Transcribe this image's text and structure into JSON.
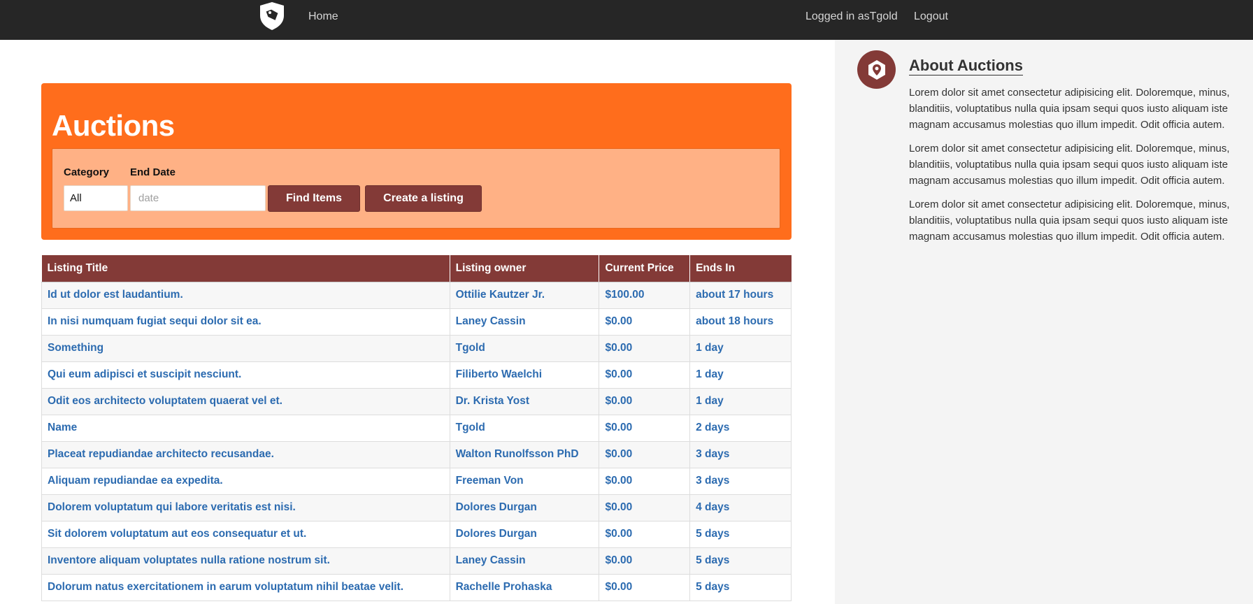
{
  "nav": {
    "home": "Home",
    "logged_in": "Logged in asTgold",
    "logout": "Logout"
  },
  "hero": {
    "title": "Auctions",
    "category_label": "Category",
    "category_value": "All",
    "end_date_label": "End Date",
    "end_date_placeholder": "date",
    "find_button": "Find Items",
    "create_button": "Create a listing"
  },
  "table": {
    "headers": [
      "Listing Title",
      "Listing owner",
      "Current Price",
      "Ends In"
    ],
    "rows": [
      [
        "Id ut dolor est laudantium.",
        "Ottilie Kautzer Jr.",
        "$100.00",
        "about 17 hours"
      ],
      [
        "In nisi numquam fugiat sequi dolor sit ea.",
        "Laney Cassin",
        "$0.00",
        "about 18 hours"
      ],
      [
        "Something",
        "Tgold",
        "$0.00",
        "1 day"
      ],
      [
        "Qui eum adipisci et suscipit nesciunt.",
        "Filiberto Waelchi",
        "$0.00",
        "1 day"
      ],
      [
        "Odit eos architecto voluptatem quaerat vel et.",
        "Dr. Krista Yost",
        "$0.00",
        "1 day"
      ],
      [
        "Name",
        "Tgold",
        "$0.00",
        "2 days"
      ],
      [
        "Placeat repudiandae architecto recusandae.",
        "Walton Runolfsson PhD",
        "$0.00",
        "3 days"
      ],
      [
        "Aliquam repudiandae ea expedita.",
        "Freeman Von",
        "$0.00",
        "3 days"
      ],
      [
        "Dolorem voluptatum qui labore veritatis est nisi.",
        "Dolores Durgan",
        "$0.00",
        "4 days"
      ],
      [
        "Sit dolorem voluptatum aut eos consequatur et ut.",
        "Dolores Durgan",
        "$0.00",
        "5 days"
      ],
      [
        "Inventore aliquam voluptates nulla ratione nostrum sit.",
        "Laney Cassin",
        "$0.00",
        "5 days"
      ],
      [
        "Dolorum natus exercitationem in earum voluptatum nihil beatae velit.",
        "Rachelle Prohaska",
        "$0.00",
        "5 days"
      ]
    ]
  },
  "sidebar": {
    "title": "About Auctions",
    "paragraphs": [
      "Lorem dolor sit amet consectetur adipisicing elit. Doloremque, minus, blanditiis, voluptatibus nulla quia ipsam sequi quos iusto aliquam iste magnam accusamus molestias quo illum impedit. Odit officia autem.",
      "Lorem dolor sit amet consectetur adipisicing elit. Doloremque, minus, blanditiis, voluptatibus nulla quia ipsam sequi quos iusto aliquam iste magnam accusamus molestias quo illum impedit. Odit officia autem.",
      "Lorem dolor sit amet consectetur adipisicing elit. Doloremque, minus, blanditiis, voluptatibus nulla quia ipsam sequi quos iusto aliquam iste magnam accusamus molestias quo illum impedit. Odit officia autem."
    ]
  },
  "icons": {
    "logo": "shield-tag-icon",
    "about": "location-pin-icon"
  },
  "colors": {
    "navbar": "#262626",
    "hero": "#ff6d1c",
    "filter_box": "#ffb185",
    "accent": "#833a37",
    "link": "#2c6bb0",
    "sidebar": "#f4f4f4"
  }
}
